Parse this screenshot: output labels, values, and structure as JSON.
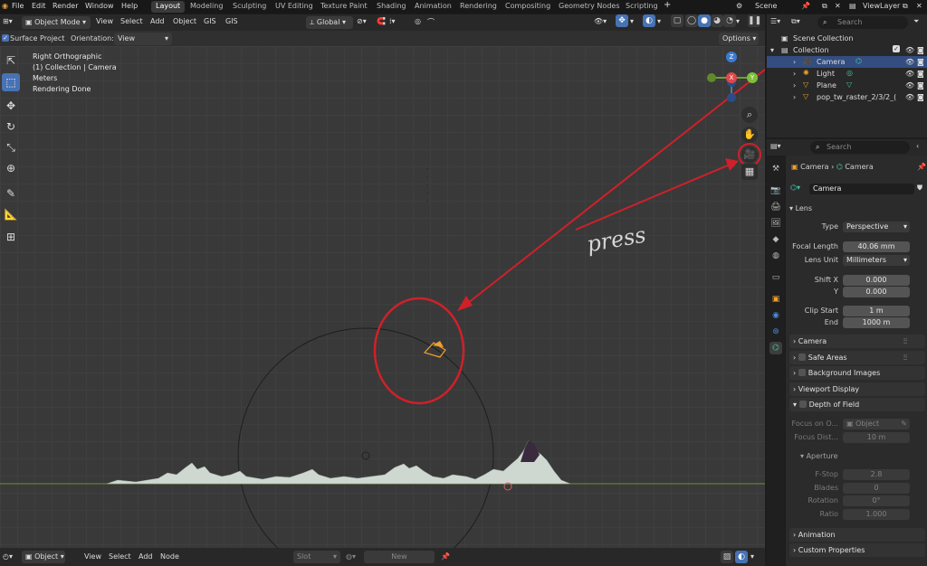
{
  "menu": {
    "items": [
      "File",
      "Edit",
      "Render",
      "Window",
      "Help"
    ],
    "workspaces": [
      "Layout",
      "Modeling",
      "Sculpting",
      "UV Editing",
      "Texture Paint",
      "Shading",
      "Animation",
      "Rendering",
      "Compositing",
      "Geometry Nodes",
      "Scripting"
    ],
    "active_workspace": "Layout",
    "add_tab": "+",
    "scene": "Scene",
    "view_layer": "ViewLayer"
  },
  "viewport_header": {
    "mode": "Object Mode",
    "menus": [
      "View",
      "Select",
      "Add",
      "Object",
      "GIS",
      "GIS"
    ],
    "orientation": "Global"
  },
  "tool_settings": {
    "surface_project": "Surface Project",
    "orientation_label": "Orientation:",
    "orientation_value": "View",
    "options": "Options"
  },
  "overlay_info": {
    "view": "Right Orthographic",
    "collection": "(1) Collection | Camera",
    "units": "Meters",
    "status": "Rendering Done"
  },
  "annotation": {
    "text": "press",
    "color": "#d0202a"
  },
  "gizmo": {
    "z": "Z",
    "x": "X",
    "y": "Y"
  },
  "bottom_bar": {
    "mode": "Object",
    "menus": [
      "View",
      "Select",
      "Add",
      "Node"
    ],
    "slot": "Slot",
    "new": "New"
  },
  "outliner": {
    "search_placeholder": "Search",
    "scene_collection": "Scene Collection",
    "collection": "Collection",
    "items": [
      "Camera",
      "Light",
      "Plane",
      "pop_tw_raster_2/3/2_("
    ],
    "selected": "Camera"
  },
  "properties": {
    "search_placeholder": "Search",
    "breadcrumb_object": "Camera",
    "breadcrumb_data": "Camera",
    "data_name": "Camera",
    "lens": {
      "title": "Lens",
      "type_label": "Type",
      "type_value": "Perspective",
      "focal_label": "Focal Length",
      "focal_value": "40.06 mm",
      "unit_label": "Lens Unit",
      "unit_value": "Millimeters",
      "shiftx_label": "Shift X",
      "shiftx_value": "0.000",
      "shifty_label": "Y",
      "shifty_value": "0.000",
      "clipstart_label": "Clip Start",
      "clipstart_value": "1 m",
      "clipend_label": "End",
      "clipend_value": "1000 m"
    },
    "sections": {
      "camera": "Camera",
      "safe_areas": "Safe Areas",
      "background_images": "Background Images",
      "viewport_display": "Viewport Display",
      "depth_of_field": "Depth of Field",
      "animation": "Animation",
      "custom_properties": "Custom Properties"
    },
    "dof": {
      "focus_on_label": "Focus on O...",
      "focus_on_value": "Object",
      "focus_dist_label": "Focus Dist...",
      "focus_dist_value": "10 m",
      "aperture": "Aperture",
      "fstop_label": "F-Stop",
      "fstop_value": "2.8",
      "blades_label": "Blades",
      "blades_value": "0",
      "rotation_label": "Rotation",
      "rotation_value": "0°",
      "ratio_label": "Ratio",
      "ratio_value": "1.000"
    }
  },
  "colors": {
    "accent": "#4772b3",
    "selection": "#334d80",
    "camera_data": "#47c1a3",
    "camera_object": "#f0a030"
  }
}
